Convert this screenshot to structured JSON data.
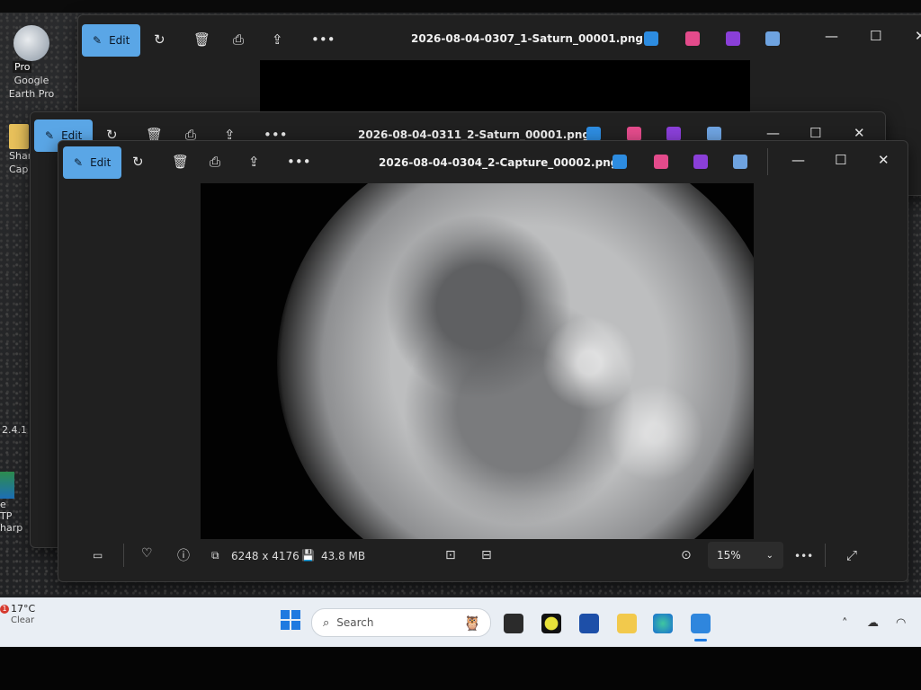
{
  "desktop": {
    "icons": [
      {
        "label": "Google Earth Pro",
        "badge": "Pro"
      },
      {
        "label": "Shar Cap"
      },
      {
        "label": "2.4.1"
      },
      {
        "label": "e TP harp"
      }
    ]
  },
  "windows": {
    "back": {
      "edit": "Edit",
      "title": "2026-08-04-0307_1-Saturn_00001.png"
    },
    "middle": {
      "edit": "Edit",
      "title": "2026-08-04-0311_2-Saturn_00001.png"
    },
    "front": {
      "edit": "Edit",
      "title": "2026-08-04-0304_2-Capture_00002.png",
      "info": {
        "dimensions": "6248 x 4176",
        "filesize": "43.8 MB",
        "zoom": "15%"
      }
    }
  },
  "taskbar": {
    "weather": {
      "temp": "17°C",
      "condition": "Clear",
      "alert": "1"
    },
    "search_placeholder": "Search"
  },
  "colors": {
    "accent": "#5aa6e6",
    "window_bg": "#202020",
    "taskbar": "#e9eef4"
  }
}
